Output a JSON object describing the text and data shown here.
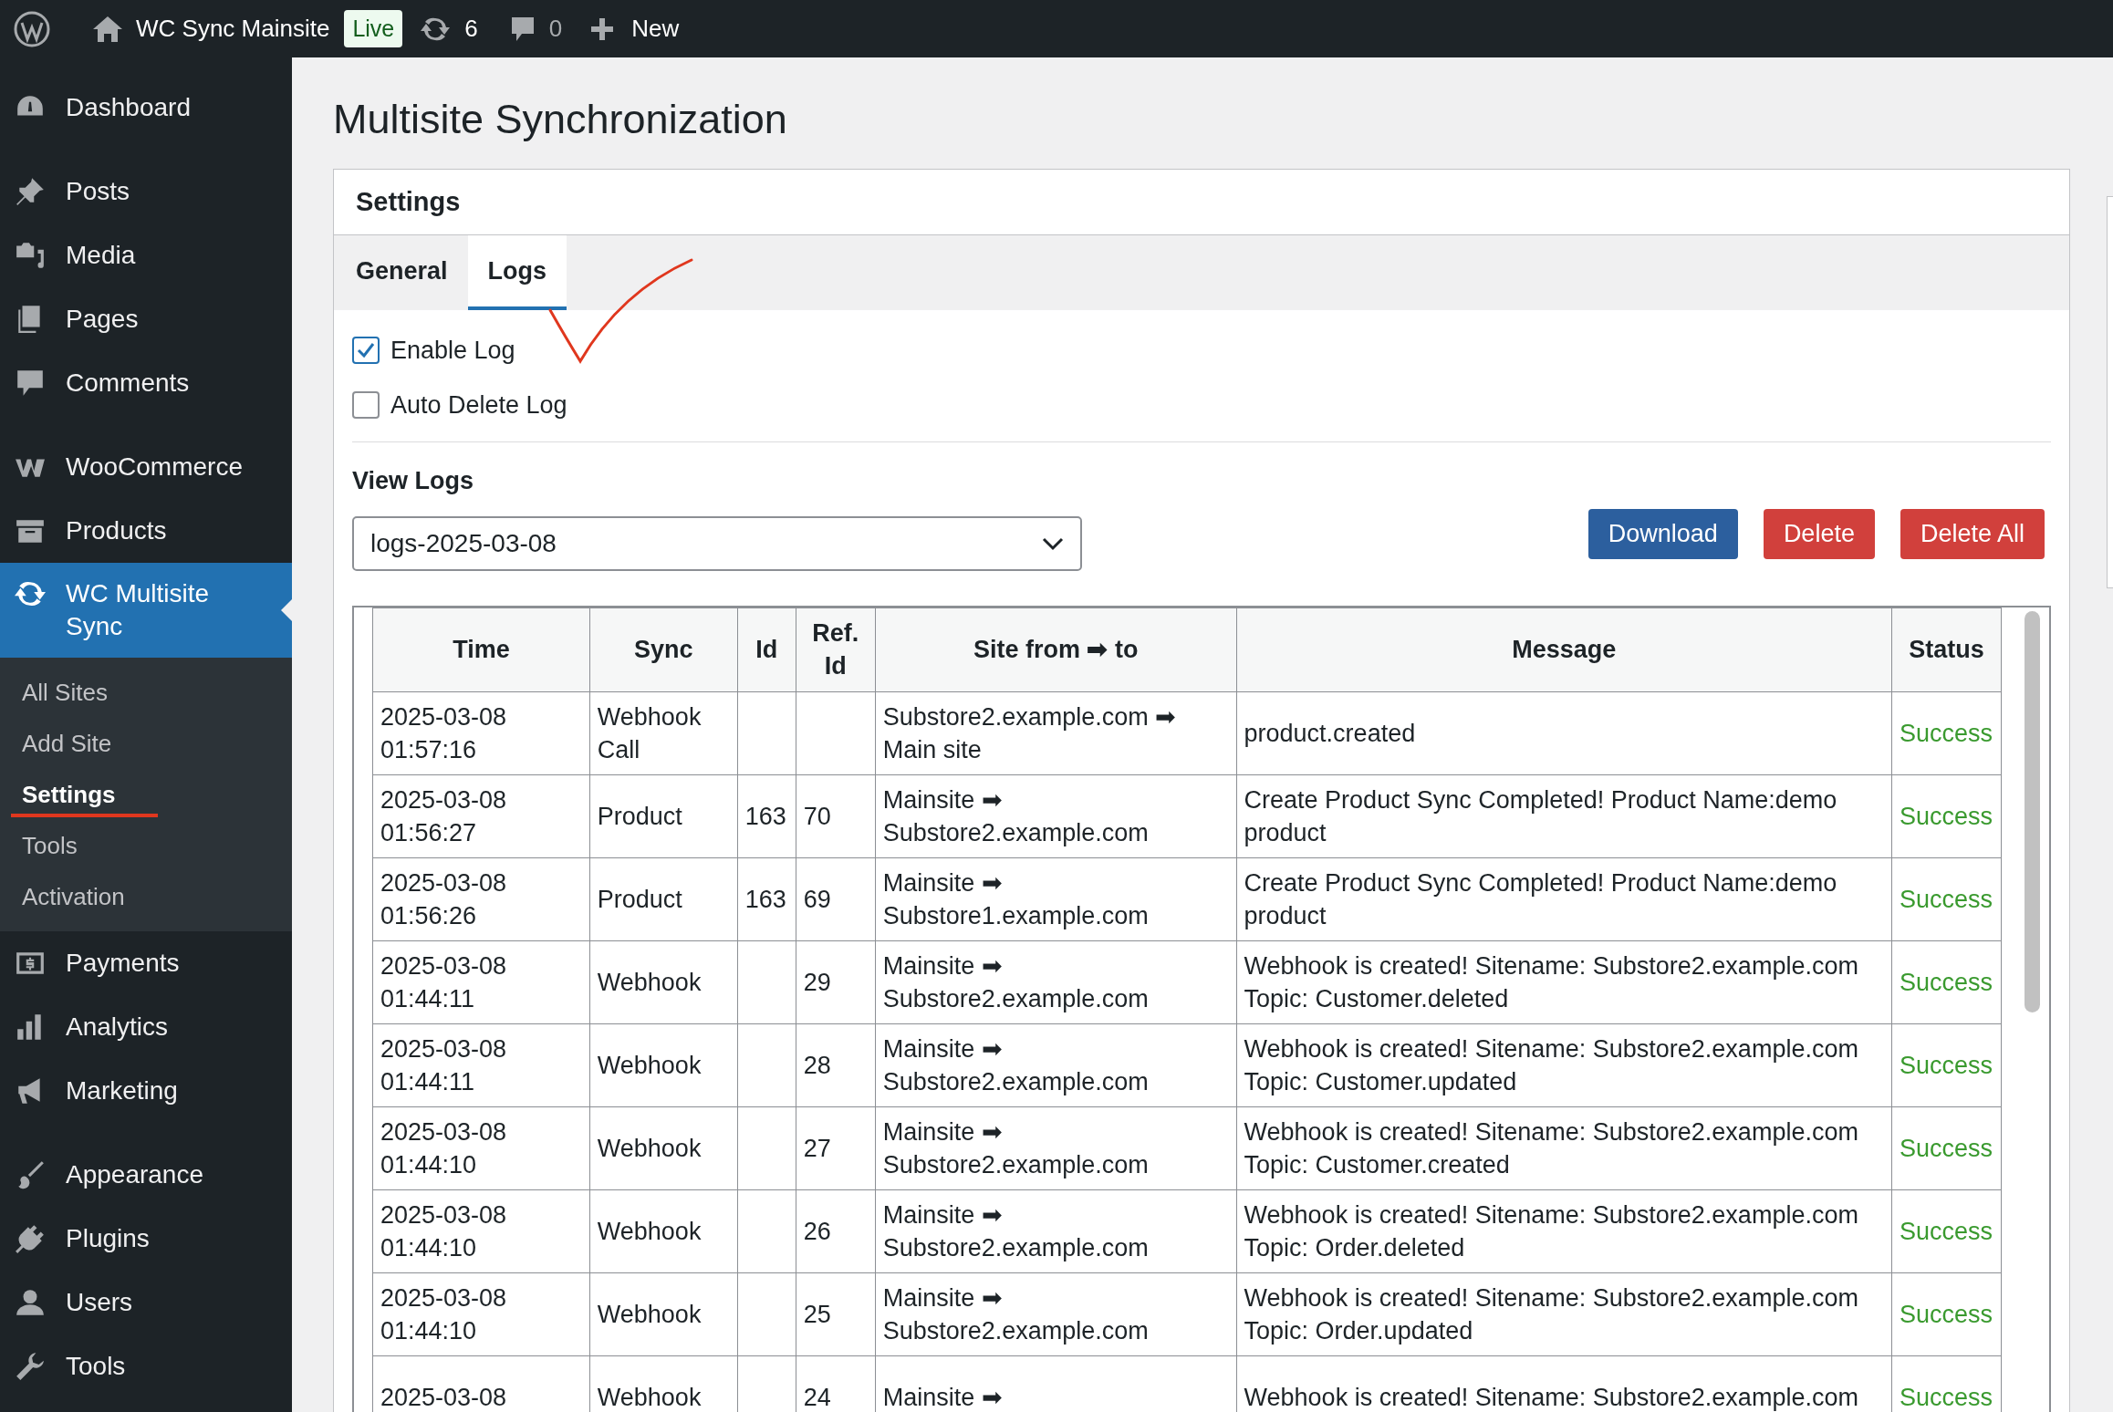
{
  "admin_bar": {
    "site_name": "WC Sync Mainsite",
    "badge": "Live",
    "updates": "6",
    "comments": "0",
    "new": "New"
  },
  "sidebar": {
    "groups": [
      [
        {
          "label": "Dashboard",
          "selected": false
        }
      ],
      [
        {
          "label": "Posts",
          "selected": false
        },
        {
          "label": "Media",
          "selected": false
        },
        {
          "label": "Pages",
          "selected": false
        },
        {
          "label": "Comments",
          "selected": false
        }
      ],
      [
        {
          "label": "WooCommerce",
          "selected": false
        },
        {
          "label": "Products",
          "selected": false
        },
        {
          "label": "WC Multisite Sync",
          "selected": true,
          "children": [
            {
              "label": "All Sites",
              "selected": false
            },
            {
              "label": "Add Site",
              "selected": false
            },
            {
              "label": "Settings",
              "selected": true
            },
            {
              "label": "Tools",
              "selected": false
            },
            {
              "label": "Activation",
              "selected": false
            }
          ]
        },
        {
          "label": "Payments",
          "selected": false
        },
        {
          "label": "Analytics",
          "selected": false
        },
        {
          "label": "Marketing",
          "selected": false
        }
      ],
      [
        {
          "label": "Appearance",
          "selected": false
        },
        {
          "label": "Plugins",
          "selected": false
        },
        {
          "label": "Users",
          "selected": false
        },
        {
          "label": "Tools",
          "selected": false
        }
      ]
    ]
  },
  "page": {
    "title": "Multisite Synchronization",
    "panel": {
      "title": "Settings",
      "tabs": [
        {
          "label": "General",
          "selected": false
        },
        {
          "label": "Logs",
          "selected": true
        }
      ],
      "options": [
        {
          "label": "Enable Log",
          "checked": true
        },
        {
          "label": "Auto Delete Log",
          "checked": false
        }
      ],
      "view_logs": {
        "label": "View Logs",
        "select_value": "logs-2025-03-08",
        "buttons": [
          {
            "label": "Download",
            "kind": "primary"
          },
          {
            "label": "Delete",
            "kind": "danger"
          },
          {
            "label": "Delete All",
            "kind": "danger"
          }
        ]
      },
      "table": {
        "columns": [
          "Time",
          "Sync",
          "Id",
          "Ref. Id",
          "Site from ➡ to",
          "Message",
          "Status"
        ],
        "rows": [
          [
            "2025-03-08 01:57:16",
            "Webhook Call",
            "",
            "",
            "Substore2.example.com ➡ Main site",
            "product.created",
            "Success"
          ],
          [
            "2025-03-08 01:56:27",
            "Product",
            "163",
            "70",
            "Mainsite ➡ Substore2.example.com",
            "Create Product Sync Completed! Product Name:demo product",
            "Success"
          ],
          [
            "2025-03-08 01:56:26",
            "Product",
            "163",
            "69",
            "Mainsite ➡ Substore1.example.com",
            "Create Product Sync Completed! Product Name:demo product",
            "Success"
          ],
          [
            "2025-03-08 01:44:11",
            "Webhook",
            "",
            "29",
            "Mainsite ➡ Substore2.example.com",
            "Webhook is created! Sitename: Substore2.example.com Topic: Customer.deleted",
            "Success"
          ],
          [
            "2025-03-08 01:44:11",
            "Webhook",
            "",
            "28",
            "Mainsite ➡ Substore2.example.com",
            "Webhook is created! Sitename: Substore2.example.com Topic: Customer.updated",
            "Success"
          ],
          [
            "2025-03-08 01:44:10",
            "Webhook",
            "",
            "27",
            "Mainsite ➡ Substore2.example.com",
            "Webhook is created! Sitename: Substore2.example.com Topic: Customer.created",
            "Success"
          ],
          [
            "2025-03-08 01:44:10",
            "Webhook",
            "",
            "26",
            "Mainsite ➡ Substore2.example.com",
            "Webhook is created! Sitename: Substore2.example.com Topic: Order.deleted",
            "Success"
          ],
          [
            "2025-03-08 01:44:10",
            "Webhook",
            "",
            "25",
            "Mainsite ➡ Substore2.example.com",
            "Webhook is created! Sitename: Substore2.example.com Topic: Order.updated",
            "Success"
          ],
          [
            "2025-03-08",
            "Webhook",
            "",
            "24",
            "Mainsite ➡",
            "Webhook is created! Sitename: Substore2.example.com",
            "Success"
          ]
        ]
      }
    }
  }
}
